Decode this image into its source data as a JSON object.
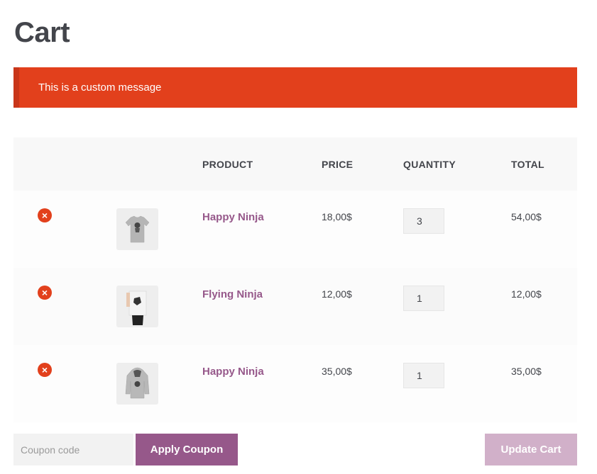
{
  "page": {
    "title": "Cart"
  },
  "notice": {
    "text": "This is a custom message",
    "color": "#e2401c"
  },
  "table": {
    "headers": [
      "",
      "",
      "PRODUCT",
      "PRICE",
      "QUANTITY",
      "TOTAL"
    ],
    "rows": [
      {
        "product": "Happy Ninja",
        "price": "18,00$",
        "quantity": "3",
        "total": "54,00$",
        "thumb_icon": "tshirt-icon"
      },
      {
        "product": "Flying Ninja",
        "price": "12,00$",
        "quantity": "1",
        "total": "12,00$",
        "thumb_icon": "poster-icon"
      },
      {
        "product": "Happy Ninja",
        "price": "35,00$",
        "quantity": "1",
        "total": "35,00$",
        "thumb_icon": "hoodie-icon"
      }
    ]
  },
  "actions": {
    "coupon_placeholder": "Coupon code",
    "apply_label": "Apply Coupon",
    "update_label": "Update Cart"
  },
  "colors": {
    "accent": "#96588a",
    "accent_disabled": "#d1b0c9",
    "error": "#e2401c"
  }
}
